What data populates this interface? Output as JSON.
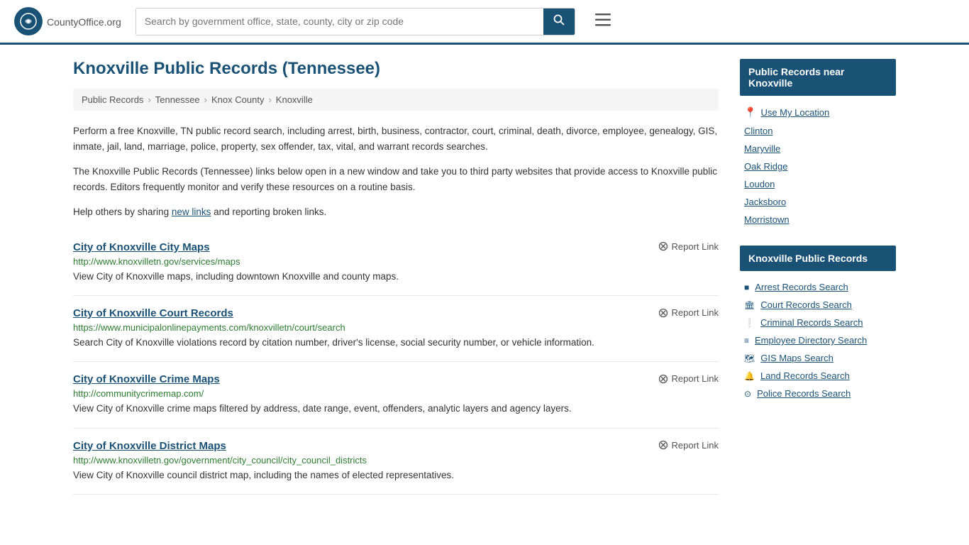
{
  "header": {
    "logo_text": "CountyOffice",
    "logo_suffix": ".org",
    "search_placeholder": "Search by government office, state, county, city or zip code",
    "search_value": ""
  },
  "page": {
    "title": "Knoxville Public Records (Tennessee)",
    "breadcrumb": [
      "Public Records",
      "Tennessee",
      "Knox County",
      "Knoxville"
    ],
    "description1": "Perform a free Knoxville, TN public record search, including arrest, birth, business, contractor, court, criminal, death, divorce, employee, genealogy, GIS, inmate, jail, land, marriage, police, property, sex offender, tax, vital, and warrant records searches.",
    "description2": "The Knoxville Public Records (Tennessee) links below open in a new window and take you to third party websites that provide access to Knoxville public records. Editors frequently monitor and verify these resources on a routine basis.",
    "description3": "Help others by sharing",
    "new_links_text": "new links",
    "description3b": "and reporting broken links.",
    "report_link_label": "Report Link"
  },
  "records": [
    {
      "title": "City of Knoxville City Maps",
      "url": "http://www.knoxvilletn.gov/services/maps",
      "desc": "View City of Knoxville maps, including downtown Knoxville and county maps."
    },
    {
      "title": "City of Knoxville Court Records",
      "url": "https://www.municipalonlinepayments.com/knoxvilletn/court/search",
      "desc": "Search City of Knoxville violations record by citation number, driver's license, social security number, or vehicle information."
    },
    {
      "title": "City of Knoxville Crime Maps",
      "url": "http://communitycrimemap.com/",
      "desc": "View City of Knoxville crime maps filtered by address, date range, event, offenders, analytic layers and agency layers."
    },
    {
      "title": "City of Knoxville District Maps",
      "url": "http://www.knoxvilletn.gov/government/city_council/city_council_districts",
      "desc": "View City of Knoxville council district map, including the names of elected representatives."
    }
  ],
  "sidebar": {
    "nearby_title": "Public Records near Knoxville",
    "nearby_items": [
      {
        "label": "Use My Location",
        "type": "location"
      },
      {
        "label": "Clinton"
      },
      {
        "label": "Maryville"
      },
      {
        "label": "Oak Ridge"
      },
      {
        "label": "Loudon"
      },
      {
        "label": "Jacksboro"
      },
      {
        "label": "Morristown"
      }
    ],
    "records_title": "Knoxville Public Records",
    "records_items": [
      {
        "label": "Arrest Records Search",
        "icon": "■"
      },
      {
        "label": "Court Records Search",
        "icon": "🏛"
      },
      {
        "label": "Criminal Records Search",
        "icon": "❕"
      },
      {
        "label": "Employee Directory Search",
        "icon": "≡"
      },
      {
        "label": "GIS Maps Search",
        "icon": "🗺"
      },
      {
        "label": "Land Records Search",
        "icon": "🔔"
      },
      {
        "label": "Police Records Search",
        "icon": "⊙"
      }
    ]
  }
}
